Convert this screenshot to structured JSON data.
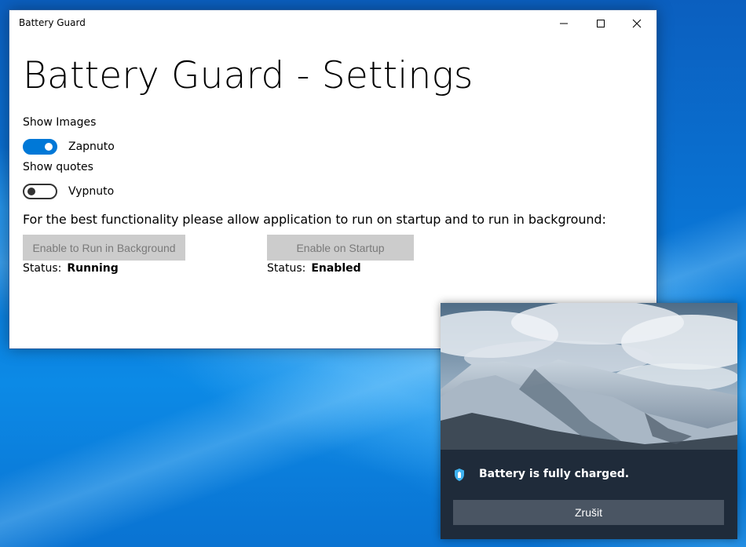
{
  "window": {
    "title": "Battery Guard",
    "controls": [
      "minimize-icon",
      "maximize-icon",
      "close-icon"
    ]
  },
  "page": {
    "title": "Battery Guard - Settings",
    "show_images": {
      "label": "Show Images",
      "state_text": "Zapnuto",
      "on": true
    },
    "show_quotes": {
      "label": "Show quotes",
      "state_text": "Vypnuto",
      "on": false
    },
    "info_text": "For the best functionality please allow application to run on startup and to run in background:",
    "background": {
      "button_label": "Enable to Run in Background",
      "status_label": "Status:",
      "status_value": "Running"
    },
    "startup": {
      "button_label": "Enable on Startup",
      "status_label": "Status:",
      "status_value": "Enabled"
    }
  },
  "toast": {
    "message": "Battery is fully charged.",
    "button_label": "Zrušit",
    "icon": "shield-battery-icon"
  },
  "colors": {
    "accent": "#0078d7",
    "toast_bg": "#1f2b3a",
    "toast_button": "#4a5563",
    "disabled_button": "#cccccc"
  }
}
